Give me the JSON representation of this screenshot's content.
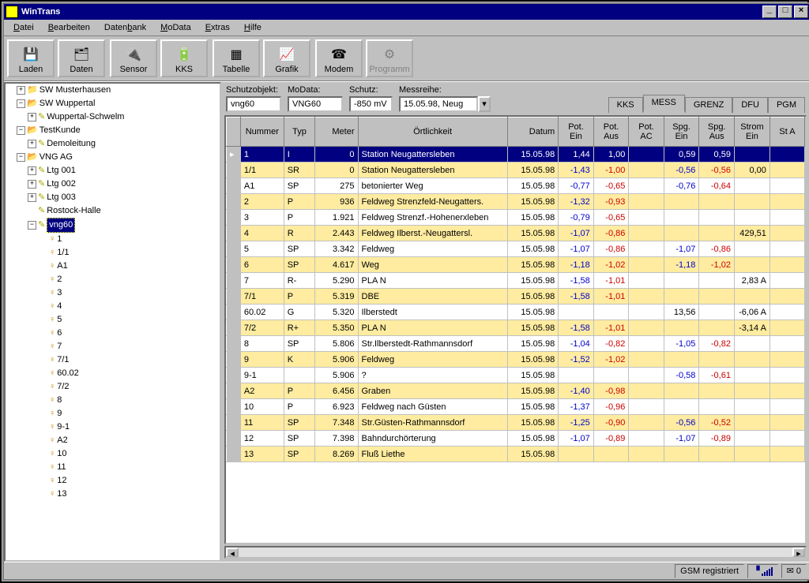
{
  "window": {
    "title": "WinTrans"
  },
  "menu": [
    "Datei",
    "Bearbeiten",
    "Datenbank",
    "MoData",
    "Extras",
    "Hilfe"
  ],
  "toolbar": {
    "laden": "Laden",
    "daten": "Daten",
    "sensor": "Sensor",
    "kks": "KKS",
    "tabelle": "Tabelle",
    "grafik": "Grafik",
    "modem": "Modem",
    "programm": "Programm"
  },
  "tree": {
    "sw_musterhausen": "SW Musterhausen",
    "sw_wuppertal": "SW Wuppertal",
    "wuppertal_schwelm": "Wuppertal-Schwelm",
    "testkunde": "TestKunde",
    "demoleitung": "Demoleitung",
    "vng_ag": "VNG AG",
    "ltg001": "Ltg 001",
    "ltg002": "Ltg 002",
    "ltg003": "Ltg 003",
    "rostock": "Rostock-Halle",
    "vng60": "vng60",
    "leaves": [
      "1",
      "1/1",
      "A1",
      "2",
      "3",
      "4",
      "5",
      "6",
      "7",
      "7/1",
      "60.02",
      "7/2",
      "8",
      "9",
      "9-1",
      "A2",
      "10",
      "11",
      "12",
      "13"
    ]
  },
  "form": {
    "schutzobjekt_label": "Schutzobjekt:",
    "schutzobjekt": "vng60",
    "modata_label": "MoData:",
    "modata": "VNG60",
    "schutz_label": "Schutz:",
    "schutz": "-850 mV",
    "messreihe_label": "Messreihe:",
    "messreihe": "15.05.98, Neug"
  },
  "tabs": {
    "kks": "KKS",
    "mess": "MESS",
    "grenz": "GRENZ",
    "dfu": "DFU",
    "pgm": "PGM"
  },
  "grid_headers": {
    "nummer": "Nummer",
    "typ": "Typ",
    "meter": "Meter",
    "ort": "Örtlichkeit",
    "datum": "Datum",
    "pot_ein": "Pot. Ein",
    "pot_aus": "Pot. Aus",
    "pot_ac": "Pot. AC",
    "spg_ein": "Spg. Ein",
    "spg_aus": "Spg. Aus",
    "strom_ein": "Strom Ein",
    "st_a": "St A"
  },
  "rows": [
    {
      "sel": true,
      "n": "1",
      "typ": "I",
      "m": "0",
      "ort": "Station Neugattersleben",
      "d": "15.05.98",
      "pe": "1,44",
      "pa": "1,00",
      "pac": "",
      "se": "0,59",
      "sa": "0,59",
      "si": ""
    },
    {
      "y": true,
      "n": "1/1",
      "typ": "SR",
      "m": "0",
      "ort": "Station Neugattersleben",
      "d": "15.05.98",
      "pe": "-1,43",
      "pa": "-1,00",
      "pac": "",
      "se": "-0,56",
      "sa": "-0,56",
      "si": "0,00"
    },
    {
      "n": "A1",
      "typ": "SP",
      "m": "275",
      "ort": "betonierter Weg",
      "d": "15.05.98",
      "pe": "-0,77",
      "pa": "-0,65",
      "pac": "",
      "se": "-0,76",
      "sa": "-0,64",
      "si": ""
    },
    {
      "y": true,
      "n": "2",
      "typ": "P",
      "m": "936",
      "ort": "Feldweg Strenzfeld-Neugatters.",
      "d": "15.05.98",
      "pe": "-1,32",
      "pa": "-0,93",
      "pac": "",
      "se": "",
      "sa": "",
      "si": ""
    },
    {
      "n": "3",
      "typ": "P",
      "m": "1.921",
      "ort": "Feldweg Strenzf.-Hohenerxleben",
      "d": "15.05.98",
      "pe": "-0,79",
      "pa": "-0,65",
      "pac": "",
      "se": "",
      "sa": "",
      "si": ""
    },
    {
      "y": true,
      "n": "4",
      "typ": "R",
      "m": "2.443",
      "ort": "Feldweg Ilberst.-Neugattersl.",
      "d": "15.05.98",
      "pe": "-1,07",
      "pa": "-0,86",
      "pac": "",
      "se": "",
      "sa": "",
      "si": "429,51"
    },
    {
      "n": "5",
      "typ": "SP",
      "m": "3.342",
      "ort": "Feldweg",
      "d": "15.05.98",
      "pe": "-1,07",
      "pa": "-0,86",
      "pac": "",
      "se": "-1,07",
      "sa": "-0,86",
      "si": ""
    },
    {
      "y": true,
      "n": "6",
      "typ": "SP",
      "m": "4.617",
      "ort": "Weg",
      "d": "15.05.98",
      "pe": "-1,18",
      "pa": "-1,02",
      "pac": "",
      "se": "-1,18",
      "sa": "-1,02",
      "si": ""
    },
    {
      "n": "7",
      "typ": "R-",
      "m": "5.290",
      "ort": "     PLA        N",
      "d": "15.05.98",
      "pe": "-1,58",
      "pa": "-1,01",
      "pac": "",
      "se": "",
      "sa": "",
      "si": "2,83 A"
    },
    {
      "y": true,
      "n": "7/1",
      "typ": "P",
      "m": "5.319",
      "ort": "DBE",
      "d": "15.05.98",
      "pe": "-1,58",
      "pa": "-1,01",
      "pac": "",
      "se": "",
      "sa": "",
      "si": ""
    },
    {
      "n": "60.02",
      "typ": "G",
      "m": "5.320",
      "ort": "Ilberstedt",
      "d": "15.05.98",
      "pe": "",
      "pa": "",
      "pac": "",
      "se": "13,56",
      "sa": "",
      "si": "-6,06 A"
    },
    {
      "y": true,
      "n": "7/2",
      "typ": "R+",
      "m": "5.350",
      "ort": "     PLA        N",
      "d": "15.05.98",
      "pe": "-1,58",
      "pa": "-1,01",
      "pac": "",
      "se": "",
      "sa": "",
      "si": "-3,14 A"
    },
    {
      "n": "8",
      "typ": "SP",
      "m": "5.806",
      "ort": "Str.Ilberstedt-Rathmannsdorf",
      "d": "15.05.98",
      "pe": "-1,04",
      "pa": "-0,82",
      "pac": "",
      "se": "-1,05",
      "sa": "-0,82",
      "si": ""
    },
    {
      "y": true,
      "n": "9",
      "typ": "K",
      "m": "5.906",
      "ort": "Feldweg",
      "d": "15.05.98",
      "pe": "-1,52",
      "pa": "-1,02",
      "pac": "",
      "se": "",
      "sa": "",
      "si": ""
    },
    {
      "n": "9-1",
      "typ": "",
      "m": "5.906",
      "ort": "?",
      "d": "15.05.98",
      "pe": "",
      "pa": "",
      "pac": "",
      "se": "-0,58",
      "sa": "-0,61",
      "si": ""
    },
    {
      "y": true,
      "n": "A2",
      "typ": "P",
      "m": "6.456",
      "ort": "Graben",
      "d": "15.05.98",
      "pe": "-1,40",
      "pa": "-0,98",
      "pac": "",
      "se": "",
      "sa": "",
      "si": ""
    },
    {
      "n": "10",
      "typ": "P",
      "m": "6.923",
      "ort": "Feldweg nach Güsten",
      "d": "15.05.98",
      "pe": "-1,37",
      "pa": "-0,96",
      "pac": "",
      "se": "",
      "sa": "",
      "si": ""
    },
    {
      "y": true,
      "n": "11",
      "typ": "SP",
      "m": "7.348",
      "ort": "Str.Güsten-Rathmannsdorf",
      "d": "15.05.98",
      "pe": "-1,25",
      "pa": "-0,90",
      "pac": "",
      "se": "-0,56",
      "sa": "-0,52",
      "si": ""
    },
    {
      "n": "12",
      "typ": "SP",
      "m": "7.398",
      "ort": "Bahndurchörterung",
      "d": "15.05.98",
      "pe": "-1,07",
      "pa": "-0,89",
      "pac": "",
      "se": "-1,07",
      "sa": "-0,89",
      "si": ""
    },
    {
      "y": true,
      "n": "13",
      "typ": "SP",
      "m": "8.269",
      "ort": "Fluß Liethe",
      "d": "15.05.98",
      "pe": "",
      "pa": "",
      "pac": "",
      "se": "",
      "sa": "",
      "si": ""
    }
  ],
  "status": {
    "gsm": "GSM registriert",
    "mail_count": "0"
  }
}
